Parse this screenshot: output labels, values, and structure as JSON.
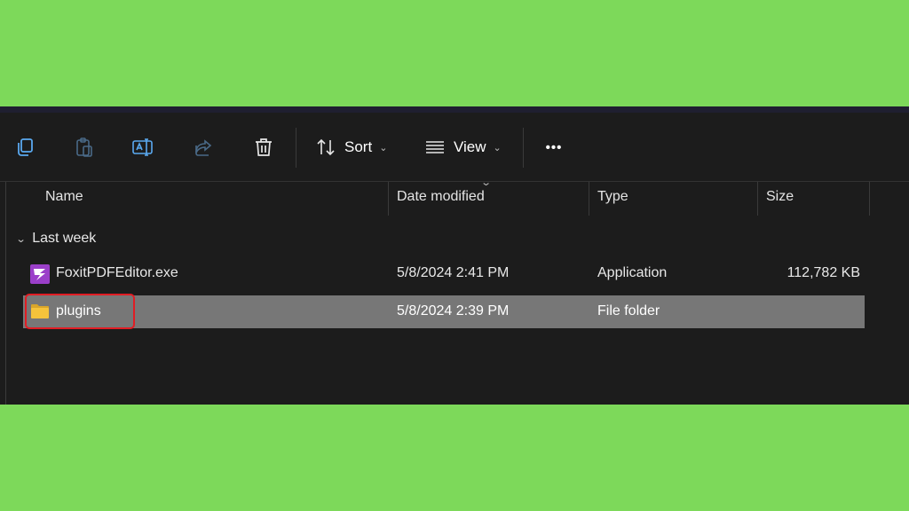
{
  "toolbar": {
    "icons": [
      "copy-icon",
      "paste-icon",
      "rename-icon",
      "share-icon",
      "delete-icon"
    ],
    "sort_label": "Sort",
    "view_label": "View",
    "more_label": "•••"
  },
  "columns": {
    "name": "Name",
    "date_modified": "Date modified",
    "type": "Type",
    "size": "Size"
  },
  "group": {
    "label": "Last week"
  },
  "files": [
    {
      "name": "FoxitPDFEditor.exe",
      "date": "5/8/2024 2:41 PM",
      "type": "Application",
      "size": "112,782 KB",
      "icon": "foxit-app-icon"
    },
    {
      "name": "plugins",
      "date": "5/8/2024 2:39 PM",
      "type": "File folder",
      "size": "",
      "icon": "folder-icon",
      "selected": true,
      "highlighted": true
    }
  ],
  "colors": {
    "background": "#7dd95a",
    "window": "#1c1c1c",
    "selection": "#777777",
    "highlight_border": "#e11d24",
    "foxit_purple": "#9b3fc9",
    "folder_yellow": "#f5c33b"
  }
}
